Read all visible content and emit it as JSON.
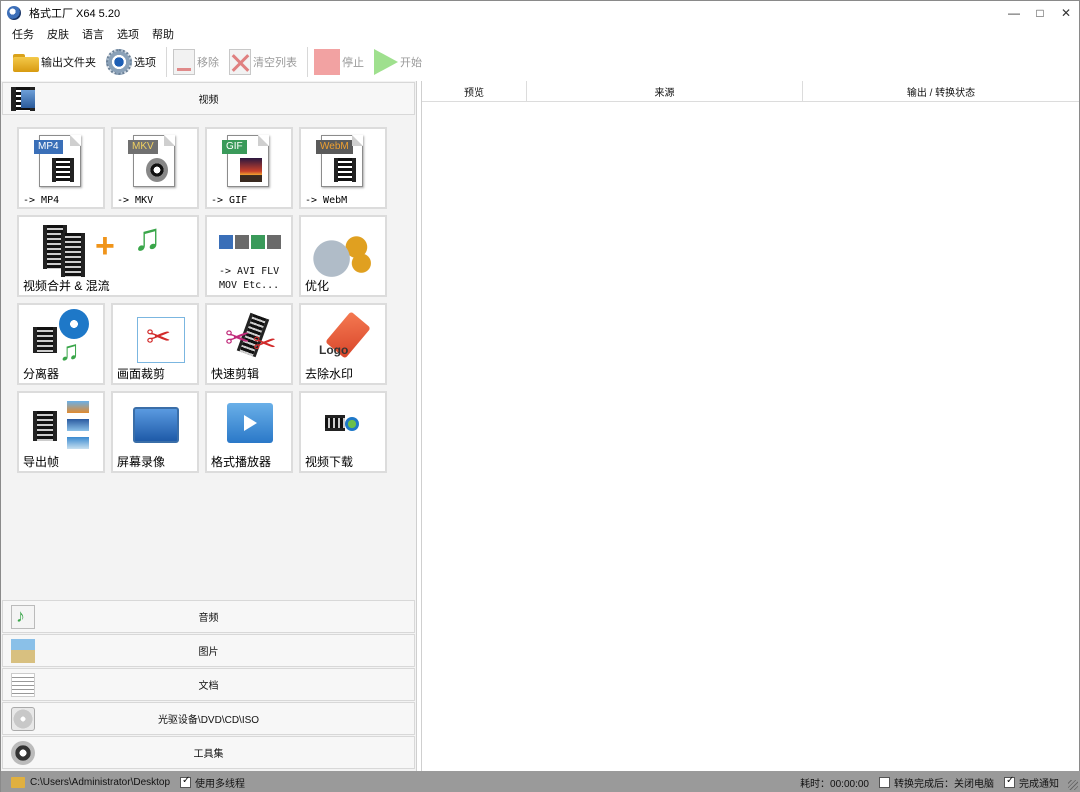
{
  "window": {
    "title": "格式工厂 X64 5.20",
    "controls": [
      "—",
      "□",
      "✕"
    ]
  },
  "menu": [
    "任务",
    "皮肤",
    "语言",
    "选项",
    "帮助"
  ],
  "toolbar": {
    "output_folder": "输出文件夹",
    "options": "选项",
    "remove": "移除",
    "clear_list": "清空列表",
    "stop": "停止",
    "start": "开始"
  },
  "categories": {
    "video": "视频",
    "audio": "音频",
    "image": "图片",
    "document": "文档",
    "disc": "光驱设备\\DVD\\CD\\ISO",
    "tools": "工具集"
  },
  "video_tiles": {
    "mp4": {
      "badge": "MP4",
      "label": "-> MP4",
      "color": "#3a6fb8"
    },
    "mkv": {
      "badge": "MKV",
      "label": "-> MKV",
      "color": "#6a6a6a"
    },
    "gif": {
      "badge": "GIF",
      "label": "-> GIF",
      "color": "#3a9a5a"
    },
    "webm": {
      "badge": "WebM",
      "label": "-> WebM",
      "color": "#d07a1a"
    },
    "merge": {
      "label": "视频合并 & 混流"
    },
    "other": {
      "line1": "-> AVI FLV",
      "line2": "MOV Etc..."
    },
    "optimize": {
      "label": "优化"
    },
    "splitter": {
      "label": "分离器"
    },
    "crop": {
      "label": "画面裁剪"
    },
    "quick_cut": {
      "label": "快速剪辑"
    },
    "remove_logo": {
      "label": "去除水印",
      "logo_text": "Logo"
    },
    "export_frames": {
      "label": "导出帧"
    },
    "screen_record": {
      "label": "屏幕录像"
    },
    "player": {
      "label": "格式播放器"
    },
    "download": {
      "label": "视频下载"
    }
  },
  "table": {
    "columns": [
      "预览",
      "来源",
      "输出 / 转换状态"
    ]
  },
  "status": {
    "path": "C:\\Users\\Administrator\\Desktop",
    "multithread": "使用多线程",
    "multithread_checked": true,
    "elapsed": "耗时：00:00:00",
    "shutdown": "转换完成后：关闭电脑",
    "shutdown_checked": false,
    "notify": "完成通知",
    "notify_checked": true
  }
}
